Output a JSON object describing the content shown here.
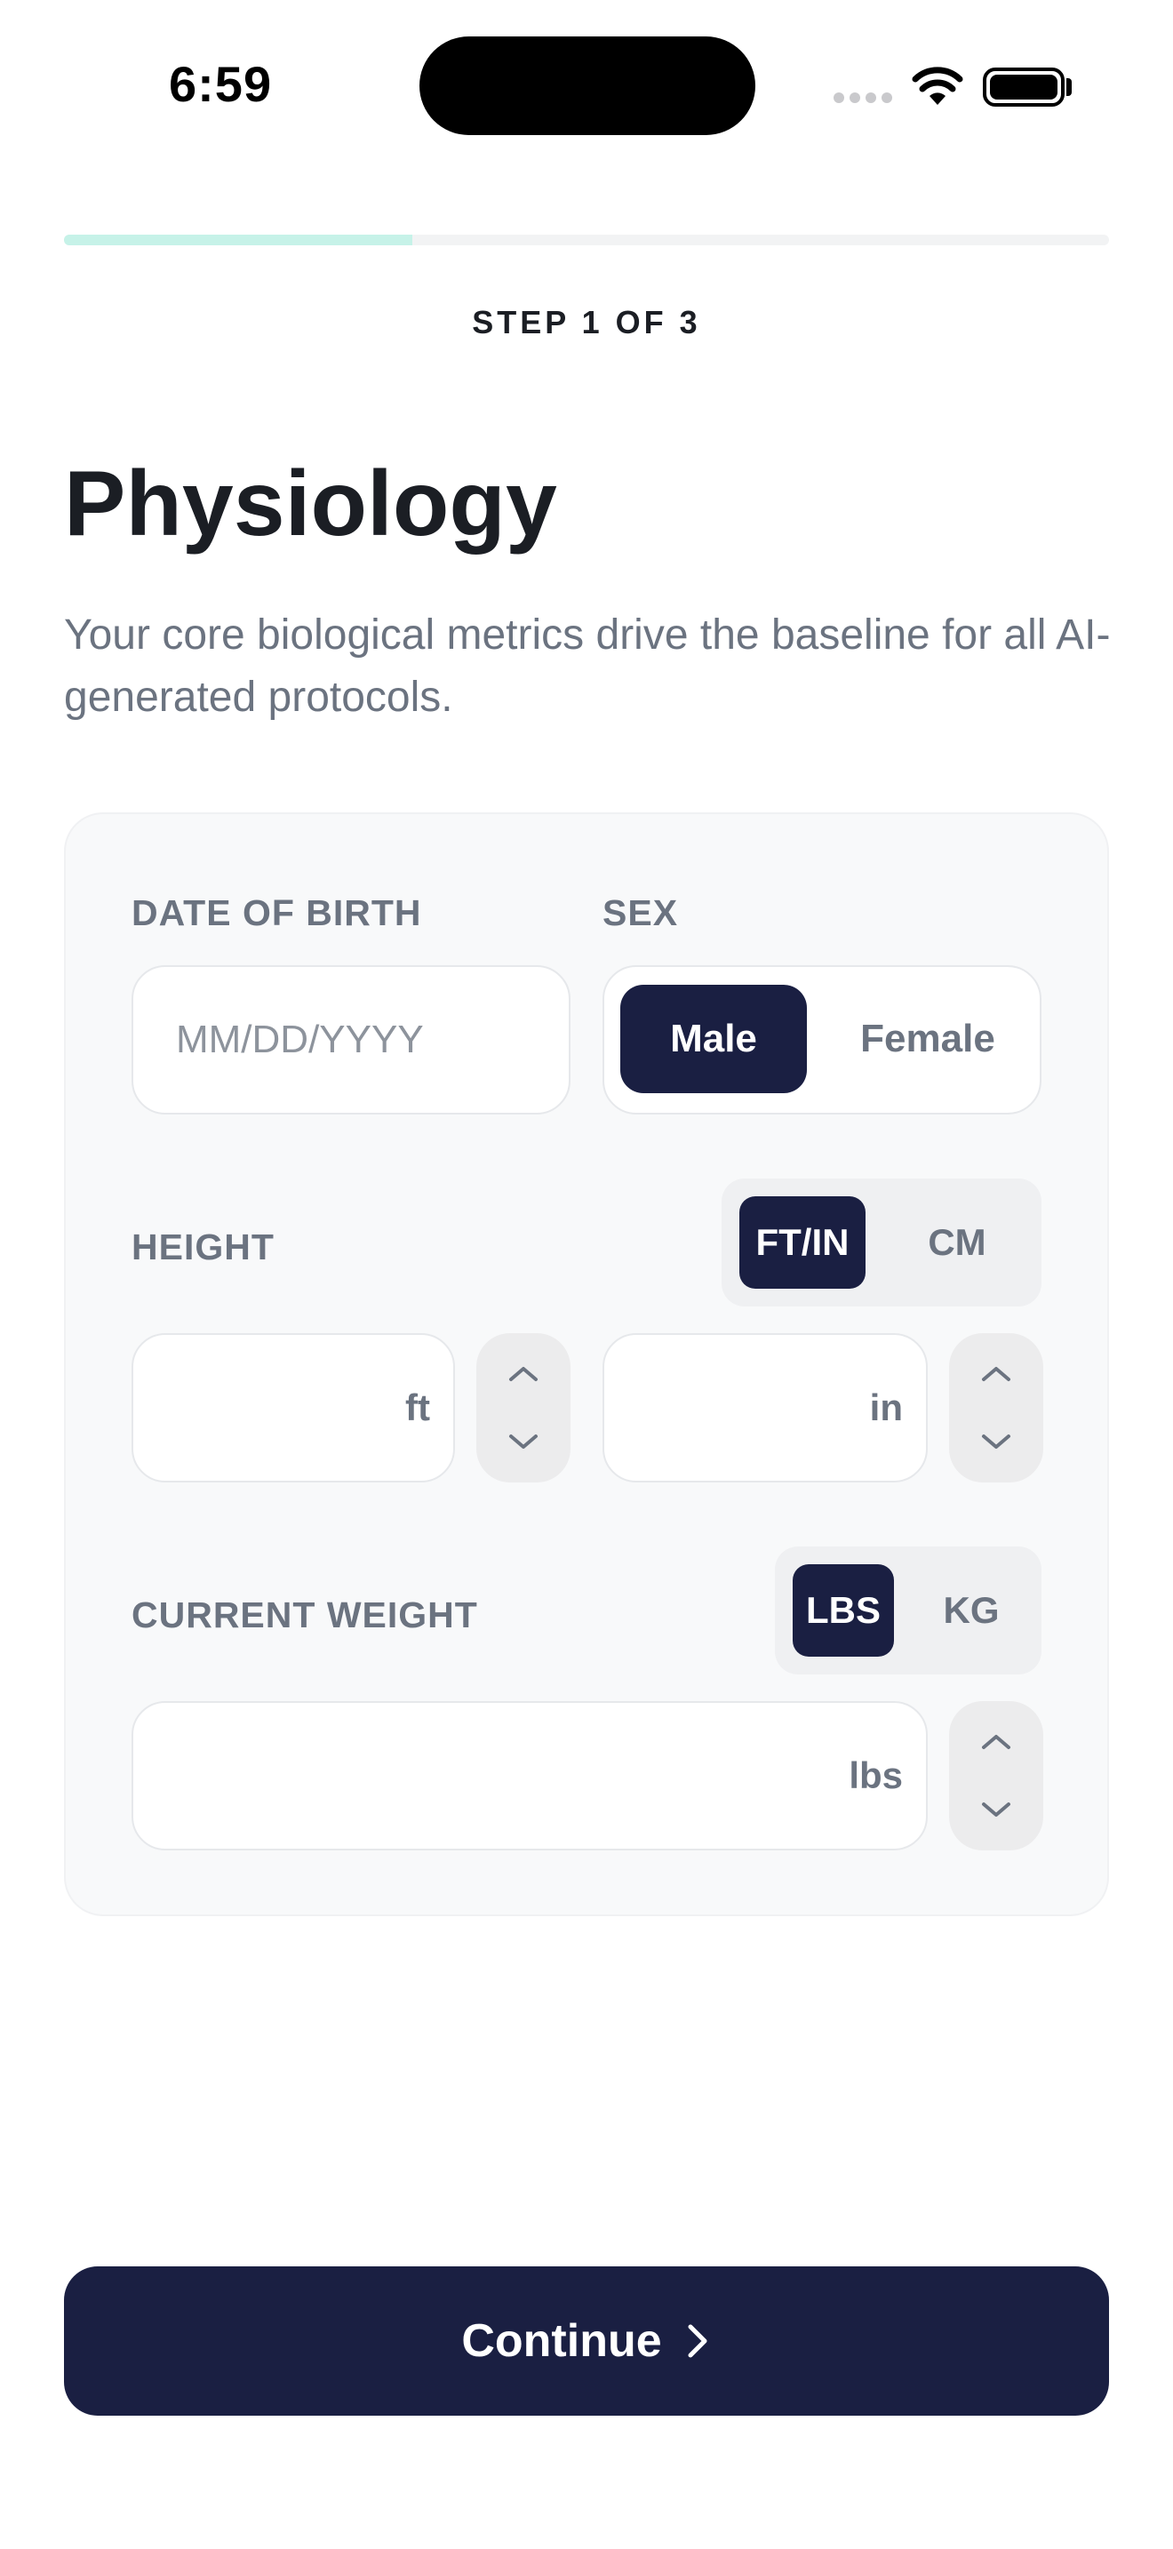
{
  "status_bar": {
    "time": "6:59"
  },
  "progress": {
    "fraction": 0.333,
    "step_label": "STEP 1 OF 3"
  },
  "header": {
    "title": "Physiology",
    "subtitle": "Your core biological metrics drive the baseline for all AI-generated protocols."
  },
  "form": {
    "dob": {
      "label": "DATE OF BIRTH",
      "placeholder": "MM/DD/YYYY",
      "value": ""
    },
    "sex": {
      "label": "SEX",
      "options": [
        "Male",
        "Female"
      ],
      "selected": "Male"
    },
    "height": {
      "label": "HEIGHT",
      "units": [
        "FT/IN",
        "CM"
      ],
      "selected_unit": "FT/IN",
      "feet_unit": "ft",
      "inches_unit": "in"
    },
    "weight": {
      "label": "CURRENT WEIGHT",
      "units": [
        "LBS",
        "KG"
      ],
      "selected_unit": "LBS",
      "unit_suffix": "lbs"
    }
  },
  "footer": {
    "continue_label": "Continue"
  },
  "colors": {
    "primary": "#1a1f42",
    "progress_fill": "#c6f2e8",
    "label_gray": "#6b7380",
    "card_bg": "#f8f9fa"
  },
  "icons": [
    "wifi-icon",
    "battery-icon",
    "chevron-up-icon",
    "chevron-down-icon",
    "chevron-right-icon"
  ]
}
